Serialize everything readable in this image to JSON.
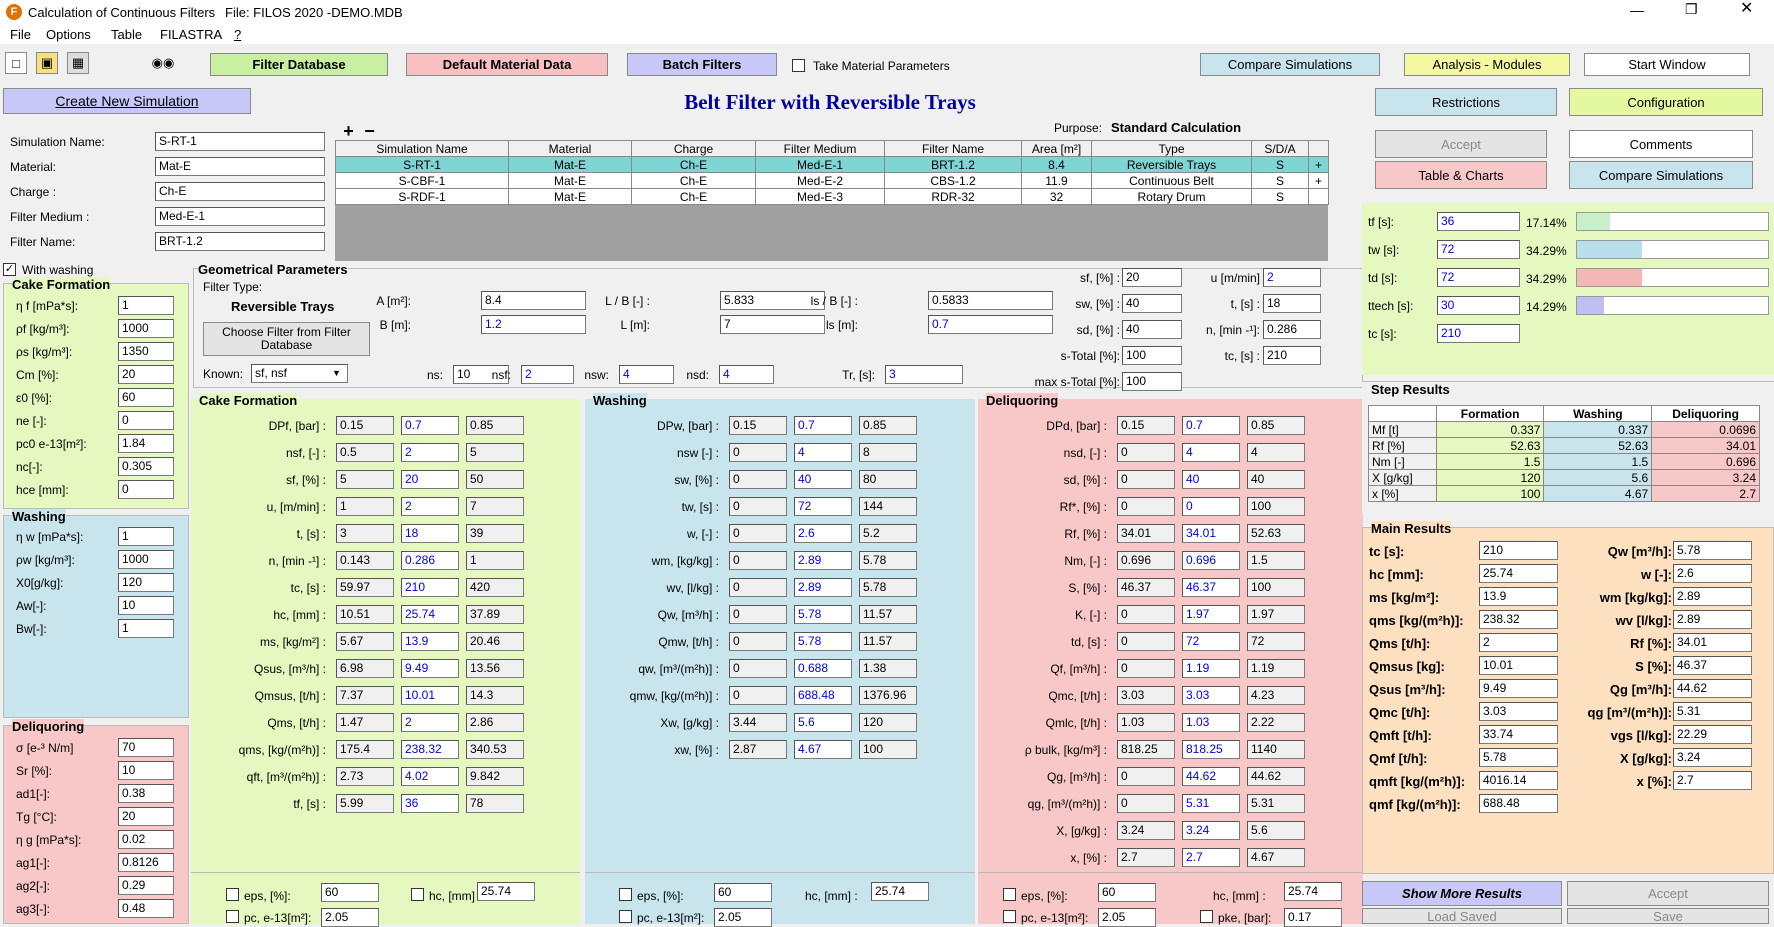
{
  "titlebar": {
    "title": "Calculation of Continuous Filters",
    "file": "File: FILOS 2020 -DEMO.MDB"
  },
  "menu": [
    "File",
    "Options",
    "Table",
    "FILASTRA",
    "?"
  ],
  "toolbar": {
    "filter_db": "Filter Database",
    "default_material": "Default Material Data",
    "batch_filters": "Batch Filters",
    "take_material": "Take Material Parameters",
    "compare_sim": "Compare Simulations",
    "analysis": "Analysis - Modules",
    "start_window": "Start Window"
  },
  "header": {
    "create_sim": "Create New Simulation",
    "title": "Belt Filter with Reversible Trays",
    "restrictions": "Restrictions",
    "configuration": "Configuration",
    "purpose_label": "Purpose:",
    "purpose_value": "Standard Calculation",
    "accept": "Accept",
    "comments": "Comments",
    "table_charts": "Table & Charts",
    "compare_sim": "Compare Simulations"
  },
  "sim_info": {
    "labels": [
      "Simulation Name:",
      "Material:",
      "Charge :",
      "Filter Medium :",
      "Filter Name:"
    ],
    "values": [
      "S-RT-1",
      "Mat-E",
      "Ch-E",
      "Med-E-1",
      "BRT-1.2"
    ]
  },
  "sim_table": {
    "headers": [
      "Simulation Name",
      "Material",
      "Charge",
      "Filter Medium",
      "Filter Name",
      "Area [m²]",
      "Type",
      "S/D/A"
    ],
    "rows": [
      [
        "S-RT-1",
        "Mat-E",
        "Ch-E",
        "Med-E-1",
        "BRT-1.2",
        "8.4",
        "Reversible Trays",
        "S",
        "+"
      ],
      [
        "S-CBF-1",
        "Mat-E",
        "Ch-E",
        "Med-E-2",
        "CBS-1.2",
        "11.9",
        "Continuous Belt",
        "S",
        "+"
      ],
      [
        "S-RDF-1",
        "Mat-E",
        "Ch-E",
        "Med-E-3",
        "RDR-32",
        "32",
        "Rotary Drum",
        "S",
        ""
      ]
    ]
  },
  "with_washing": "With washing",
  "left_cake": {
    "title": "Cake Formation",
    "labels": [
      "η f [mPa*s]:",
      "ρf [kg/m³]:",
      "ρs [kg/m³]:",
      "Cm [%]:",
      "ε0 [%]:",
      "ne [-]:",
      "pc0 e-13[m²]:",
      "nc[-]:",
      "hce [mm]:"
    ],
    "values": [
      "1",
      "1000",
      "1350",
      "20",
      "60",
      "0",
      "1.84",
      "0.305",
      "0"
    ]
  },
  "left_wash": {
    "title": "Washing",
    "labels": [
      "η w [mPa*s]:",
      "ρw [kg/m³]:",
      "X0[g/kg]:",
      "Aw[-]:",
      "Bw[-]:"
    ],
    "values": [
      "1",
      "1000",
      "120",
      "10",
      "1"
    ]
  },
  "left_deliq": {
    "title": "Deliquoring",
    "labels": [
      "σ [e-³ N/m]",
      "Sr [%]:",
      "ad1[-]:",
      "Tg [°C]:",
      "η g [mPa*s]:",
      "ag1[-]:",
      "ag2[-]:",
      "ag3[-]:"
    ],
    "values": [
      "70",
      "10",
      "0.38",
      "20",
      "0.02",
      "0.8126",
      "0.29",
      "0.48"
    ]
  },
  "geom": {
    "title": "Geometrical Parameters",
    "filter_type_label": "Filter Type:",
    "filter_type": "Reversible Trays",
    "choose_btn": "Choose Filter from Filter Database",
    "known_label": "Known:",
    "known_value": "sf, nsf",
    "A_label": "A [m²]:",
    "A": "8.4",
    "B_label": "B [m]:",
    "B": "1.2",
    "LB_label": "L / B [-] :",
    "LB": "5.833",
    "L_label": "L [m]:",
    "L": "7",
    "lsB_label": "ls / B [-] :",
    "lsB": "0.5833",
    "ls_label": "ls [m]:",
    "ls": "0.7",
    "ns_label": "ns:",
    "ns": "10",
    "nsf_label": "nsf:",
    "nsf": "2",
    "nsw_label": "nsw:",
    "nsw": "4",
    "nsd_label": "nsd:",
    "nsd": "4",
    "Tr_label": "Tr, [s]:",
    "Tr": "3"
  },
  "geom_right": {
    "labels": [
      "sf, [%] :",
      "sw, [%] :",
      "sd, [%] :",
      "s-Total [%]:",
      "max s-Total [%]:"
    ],
    "values": [
      "20",
      "40",
      "40",
      "100",
      "100"
    ],
    "labels2": [
      "u [m/min]",
      "t, [s] :",
      "n, [min -¹]:",
      "tc, [s] :"
    ],
    "values2": [
      "2",
      "18",
      "0.286",
      "210"
    ]
  },
  "cake": {
    "title": "Cake Formation",
    "rows": [
      [
        "DPf, [bar] :",
        "0.15",
        "0.7",
        "0.85"
      ],
      [
        "nsf, [-] :",
        "0.5",
        "2",
        "5"
      ],
      [
        "sf, [%] :",
        "5",
        "20",
        "50"
      ],
      [
        "u, [m/min] :",
        "1",
        "2",
        "7"
      ],
      [
        "t, [s] :",
        "3",
        "18",
        "39"
      ],
      [
        "n, [min -¹] :",
        "0.143",
        "0.286",
        "1"
      ],
      [
        "tc, [s] :",
        "59.97",
        "210",
        "420"
      ],
      [
        "hc, [mm] :",
        "10.51",
        "25.74",
        "37.89"
      ],
      [
        "ms, [kg/m²] :",
        "5.67",
        "13.9",
        "20.46"
      ],
      [
        "Qsus, [m³/h] :",
        "6.98",
        "9.49",
        "13.56"
      ],
      [
        "Qmsus, [t/h] :",
        "7.37",
        "10.01",
        "14.3"
      ],
      [
        "Qms, [t/h] :",
        "1.47",
        "2",
        "2.86"
      ],
      [
        "qms, [kg/(m²h)] :",
        "175.4",
        "238.32",
        "340.53"
      ],
      [
        "qft, [m³/(m²h)] :",
        "2.73",
        "4.02",
        "9.842"
      ],
      [
        "tf, [s] :",
        "5.99",
        "36",
        "78"
      ]
    ],
    "eps_label": "eps, [%]:",
    "eps": "60",
    "hc_label": "hc, [mm]",
    "hc": "25.74",
    "pc_label": "pc, e-13[m²]:",
    "pc": "2.05"
  },
  "wash": {
    "title": "Washing",
    "rows": [
      [
        "DPw, [bar] :",
        "0.15",
        "0.7",
        "0.85"
      ],
      [
        "nsw [-] :",
        "0",
        "4",
        "8"
      ],
      [
        "sw, [%] :",
        "0",
        "40",
        "80"
      ],
      [
        "tw, [s] :",
        "0",
        "72",
        "144"
      ],
      [
        "w, [-] :",
        "0",
        "2.6",
        "5.2"
      ],
      [
        "wm, [kg/kg] :",
        "0",
        "2.89",
        "5.78"
      ],
      [
        "wv, [l/kg] :",
        "0",
        "2.89",
        "5.78"
      ],
      [
        "Qw, [m³/h] :",
        "0",
        "5.78",
        "11.57"
      ],
      [
        "Qmw, [t/h] :",
        "0",
        "5.78",
        "11.57"
      ],
      [
        "qw, [m³/(m²h)] :",
        "0",
        "0.688",
        "1.38"
      ],
      [
        "qmw, [kg/(m²h)] :",
        "0",
        "688.48",
        "1376.96"
      ],
      [
        "Xw, [g/kg] :",
        "3.44",
        "5.6",
        "120"
      ],
      [
        "xw, [%] :",
        "2.87",
        "4.67",
        "100"
      ]
    ],
    "eps_label": "eps, [%]:",
    "eps": "60",
    "hc_label": "hc, [mm] :",
    "hc": "25.74",
    "pc_label": "pc, e-13[m²]:",
    "pc": "2.05"
  },
  "deliq": {
    "title": "Deliquoring",
    "rows": [
      [
        "DPd, [bar] :",
        "0.15",
        "0.7",
        "0.85"
      ],
      [
        "nsd, [-] :",
        "0",
        "4",
        "4"
      ],
      [
        "sd, [%] :",
        "0",
        "40",
        "40"
      ],
      [
        "Rf*, [%] :",
        "0",
        "0",
        "100"
      ],
      [
        "Rf, [%] :",
        "34.01",
        "34.01",
        "52.63"
      ],
      [
        "Nm, [-] :",
        "0.696",
        "0.696",
        "1.5"
      ],
      [
        "S, [%] :",
        "46.37",
        "46.37",
        "100"
      ],
      [
        "K, [-] :",
        "0",
        "1.97",
        "1.97"
      ],
      [
        "td, [s] :",
        "0",
        "72",
        "72"
      ],
      [
        "Qf, [m³/h] :",
        "0",
        "1.19",
        "1.19"
      ],
      [
        "Qmc, [t/h] :",
        "3.03",
        "3.03",
        "4.23"
      ],
      [
        "Qmlc, [t/h] :",
        "1.03",
        "1.03",
        "2.22"
      ],
      [
        "ρ bulk, [kg/m³] :",
        "818.25",
        "818.25",
        "1140"
      ],
      [
        "Qg, [m³/h] :",
        "0",
        "44.62",
        "44.62"
      ],
      [
        "qg, [m³/(m²h)] :",
        "0",
        "5.31",
        "5.31"
      ],
      [
        "X, [g/kg] :",
        "3.24",
        "3.24",
        "5.6"
      ],
      [
        "x, [%] :",
        "2.7",
        "2.7",
        "4.67"
      ]
    ],
    "eps_label": "eps, [%]:",
    "eps": "60",
    "hc_label": "hc, [mm] :",
    "hc": "25.74",
    "pc_label": "pc, e-13[m²]:",
    "pc": "2.05",
    "pke_label": "pke, [bar]:",
    "pke": "0.17"
  },
  "times": {
    "rows": [
      [
        "tf [s]:",
        "36",
        "17.14%"
      ],
      [
        "tw [s]:",
        "72",
        "34.29%"
      ],
      [
        "td [s]:",
        "72",
        "34.29%"
      ],
      [
        "ttech [s]:",
        "30",
        "14.29%"
      ],
      [
        "tc [s]:",
        "210",
        ""
      ]
    ],
    "fractions": [
      0.1714,
      0.3429,
      0.3429,
      0.1429
    ],
    "colors": [
      "#c8f0c8",
      "#b8e0ec",
      "#f4b8b8",
      "#c0c0f0"
    ]
  },
  "step": {
    "title": "Step Results",
    "headers": [
      "",
      "Formation",
      "Washing",
      "Deliquoring"
    ],
    "rows": [
      [
        "Mf [t]",
        "0.337",
        "0.337",
        "0.0696"
      ],
      [
        "Rf [%]",
        "52.63",
        "52.63",
        "34.01"
      ],
      [
        "Nm [-]",
        "1.5",
        "1.5",
        "0.696"
      ],
      [
        "X [g/kg]",
        "120",
        "5.6",
        "3.24"
      ],
      [
        "x [%]",
        "100",
        "4.67",
        "2.7"
      ]
    ]
  },
  "main": {
    "title": "Main Results",
    "left": [
      [
        "tc [s]:",
        "210"
      ],
      [
        "hc [mm]:",
        "25.74"
      ],
      [
        "ms [kg/m²]:",
        "13.9"
      ],
      [
        "qms [kg/(m²h)]:",
        "238.32"
      ],
      [
        "Qms [t/h]:",
        "2"
      ],
      [
        "Qmsus [kg]:",
        "10.01"
      ],
      [
        "Qsus [m³/h]:",
        "9.49"
      ],
      [
        "Qmc [t/h]:",
        "3.03"
      ],
      [
        "Qmft [t/h]:",
        "33.74"
      ],
      [
        "Qmf [t/h]:",
        "5.78"
      ],
      [
        "qmft [kg/(m²h)]:",
        "4016.14"
      ],
      [
        "qmf [kg/(m²h)]:",
        "688.48"
      ]
    ],
    "right": [
      [
        "Qw [m³/h]:",
        "5.78"
      ],
      [
        "w [-]:",
        "2.6"
      ],
      [
        "wm [kg/kg]:",
        "2.89"
      ],
      [
        "wv [l/kg]:",
        "2.89"
      ],
      [
        "Rf [%]:",
        "34.01"
      ],
      [
        "S [%]:",
        "46.37"
      ],
      [
        "Qg [m³/h]:",
        "44.62"
      ],
      [
        "qg [m³/(m²h)]:",
        "5.31"
      ],
      [
        "vgs [l/kg]:",
        "22.29"
      ],
      [
        "X [g/kg]:",
        "3.24"
      ],
      [
        "x [%]:",
        "2.7"
      ]
    ]
  },
  "bottom": {
    "show_more": "Show More Results",
    "accept": "Accept",
    "load_saved": "Load Saved",
    "save": "Save"
  },
  "colors": {
    "green": "#e4f8c0",
    "blue": "#c8e4ec",
    "red": "#f8c8c8",
    "purple": "#c8c8f8",
    "orange": "#fde0c0",
    "title_blue": "#0000a0"
  }
}
